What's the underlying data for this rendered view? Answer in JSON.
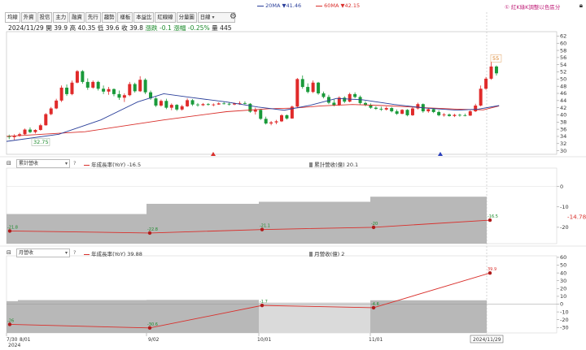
{
  "legend_top": {
    "ma20_label": "20MA",
    "ma20_value": "▼41.46",
    "ma60_label": "60MA",
    "ma60_value": "▼42.15",
    "note": "① 紅K綠K調整以色區分",
    "ma20_color": "#2a3f9a",
    "ma60_color": "#d9302c"
  },
  "toolbar": {
    "tabs": [
      "均線",
      "外資",
      "投信",
      "主力",
      "融資",
      "先行",
      "趨勢",
      "樣板",
      "本益比",
      "紅線線",
      "分量圖"
    ],
    "period": "日線",
    "settings_icon": "gear-icon"
  },
  "quote": {
    "date": "2024/11/29",
    "open": "開 39.9",
    "high": "高 40.35",
    "low": "低 39.6",
    "close": "收 39.8",
    "change": "漲跌 -0.1",
    "change_pct": "漲幅 -0.25%",
    "volume": "量 445"
  },
  "panel2": {
    "select": "累計營收",
    "help": "?",
    "legend_line": "年成長率(YoY) -16.5",
    "legend_bar": "累計營收(億) 20.1"
  },
  "panel3": {
    "select": "月營收",
    "help": "?",
    "legend_line": "年成長率(YoY) 39.88",
    "legend_bar": "月營收(億) 2"
  },
  "chart_data": [
    {
      "type": "candlestick",
      "yticks": [
        30,
        32,
        34,
        36,
        38,
        40,
        42,
        44,
        46,
        48,
        50,
        52,
        54,
        56,
        58,
        60,
        62
      ],
      "ylim": [
        29,
        63
      ],
      "x_range": [
        0,
        105
      ],
      "candles": [
        [
          34.1,
          34.5,
          33.2,
          33.8
        ],
        [
          33.8,
          34.6,
          33.0,
          34.2
        ],
        [
          34.2,
          35.0,
          33.9,
          34.6
        ],
        [
          34.6,
          36.2,
          34.4,
          35.9
        ],
        [
          35.9,
          36.5,
          34.9,
          35.2
        ],
        [
          35.2,
          36.0,
          34.8,
          35.8
        ],
        [
          35.8,
          37.5,
          35.6,
          37.1
        ],
        [
          37.1,
          40.5,
          37.0,
          40.2
        ],
        [
          40.2,
          42.2,
          39.9,
          41.8
        ],
        [
          41.8,
          44.5,
          41.6,
          44.0
        ],
        [
          44.0,
          48.2,
          43.6,
          47.6
        ],
        [
          47.6,
          48.5,
          45.3,
          45.8
        ],
        [
          45.8,
          49.6,
          45.5,
          49.0
        ],
        [
          49.0,
          52.5,
          48.8,
          52.2
        ],
        [
          52.2,
          52.5,
          48.7,
          49.2
        ],
        [
          49.2,
          50.2,
          47.0,
          47.6
        ],
        [
          47.6,
          49.6,
          47.3,
          49.2
        ],
        [
          49.2,
          49.5,
          46.8,
          47.3
        ],
        [
          47.3,
          48.2,
          45.8,
          46.5
        ],
        [
          46.5,
          47.8,
          45.6,
          47.2
        ],
        [
          47.2,
          47.4,
          45.2,
          45.8
        ],
        [
          45.8,
          46.8,
          44.2,
          44.8
        ],
        [
          44.8,
          46.0,
          43.6,
          45.5
        ],
        [
          45.5,
          49.2,
          45.2,
          48.6
        ],
        [
          48.6,
          49.0,
          46.2,
          46.6
        ],
        [
          46.6,
          50.8,
          46.4,
          49.8
        ],
        [
          49.8,
          50.2,
          45.8,
          46.3
        ],
        [
          46.3,
          46.8,
          44.2,
          44.6
        ],
        [
          44.6,
          45.0,
          42.2,
          42.6
        ],
        [
          42.6,
          44.3,
          42.3,
          43.9
        ],
        [
          43.9,
          44.5,
          41.6,
          42.0
        ],
        [
          42.0,
          43.2,
          41.3,
          42.8
        ],
        [
          42.8,
          43.0,
          41.1,
          41.5
        ],
        [
          41.5,
          42.8,
          41.2,
          42.4
        ],
        [
          42.4,
          44.6,
          42.2,
          44.1
        ],
        [
          44.1,
          44.4,
          42.5,
          42.9
        ],
        [
          42.9,
          43.3,
          42.3,
          42.7
        ],
        [
          42.7,
          43.3,
          42.5,
          43.0
        ],
        [
          43.0,
          43.3,
          42.6,
          42.8
        ],
        [
          42.8,
          43.2,
          42.4,
          42.9
        ],
        [
          42.9,
          43.5,
          42.8,
          43.2
        ],
        [
          43.2,
          43.6,
          42.9,
          43.1
        ],
        [
          43.1,
          43.4,
          42.6,
          42.9
        ],
        [
          42.9,
          43.4,
          42.7,
          43.2
        ],
        [
          43.2,
          43.8,
          42.8,
          43.3
        ],
        [
          43.3,
          43.8,
          42.9,
          43.1
        ],
        [
          43.1,
          43.3,
          40.6,
          40.9
        ],
        [
          40.9,
          42.0,
          40.1,
          41.4
        ],
        [
          41.4,
          41.6,
          38.6,
          38.9
        ],
        [
          38.9,
          39.5,
          37.3,
          37.6
        ],
        [
          37.6,
          38.3,
          37.1,
          37.9
        ],
        [
          37.9,
          38.6,
          37.4,
          38.2
        ],
        [
          38.2,
          40.2,
          38.0,
          39.9
        ],
        [
          39.9,
          40.1,
          38.7,
          39.0
        ],
        [
          39.0,
          42.6,
          38.9,
          42.3
        ],
        [
          42.3,
          50.3,
          42.1,
          50.0
        ],
        [
          50.0,
          51.0,
          47.3,
          47.8
        ],
        [
          47.8,
          48.8,
          46.0,
          46.4
        ],
        [
          46.4,
          49.6,
          46.1,
          49.0
        ],
        [
          49.0,
          49.2,
          45.6,
          46.0
        ],
        [
          46.0,
          46.5,
          44.6,
          45.0
        ],
        [
          45.0,
          45.6,
          43.0,
          43.4
        ],
        [
          43.4,
          44.3,
          42.4,
          42.7
        ],
        [
          42.7,
          45.2,
          42.5,
          44.8
        ],
        [
          44.8,
          45.2,
          43.3,
          43.7
        ],
        [
          43.7,
          46.2,
          43.5,
          45.8
        ],
        [
          45.8,
          46.3,
          44.6,
          45.0
        ],
        [
          45.0,
          45.4,
          42.9,
          43.3
        ],
        [
          43.3,
          43.8,
          42.4,
          42.8
        ],
        [
          42.8,
          43.2,
          41.7,
          42.0
        ],
        [
          42.0,
          42.4,
          41.4,
          41.7
        ],
        [
          41.7,
          42.3,
          41.1,
          41.5
        ],
        [
          41.5,
          42.3,
          41.2,
          41.9
        ],
        [
          41.9,
          42.2,
          40.7,
          41.0
        ],
        [
          41.0,
          41.5,
          40.0,
          40.3
        ],
        [
          40.3,
          41.6,
          40.2,
          41.4
        ],
        [
          41.4,
          41.6,
          39.6,
          39.9
        ],
        [
          39.9,
          42.2,
          39.7,
          41.8
        ],
        [
          41.8,
          43.4,
          41.5,
          43.0
        ],
        [
          43.0,
          43.2,
          40.6,
          41.0
        ],
        [
          41.0,
          41.9,
          40.6,
          41.6
        ],
        [
          41.6,
          41.9,
          40.5,
          40.8
        ],
        [
          40.8,
          41.3,
          39.6,
          39.9
        ],
        [
          39.9,
          40.5,
          39.5,
          40.1
        ],
        [
          40.1,
          40.4,
          39.5,
          39.7
        ],
        [
          39.7,
          40.3,
          39.4,
          40.0
        ],
        [
          40.0,
          40.3,
          39.5,
          39.9
        ],
        [
          39.9,
          40.35,
          39.6,
          39.8
        ],
        [
          39.8,
          41.3,
          39.7,
          41.0
        ],
        [
          41.0,
          43.1,
          40.8,
          42.6
        ],
        [
          42.6,
          48.2,
          42.4,
          47.3
        ],
        [
          47.3,
          50.6,
          47.0,
          50.1
        ],
        [
          50.1,
          55.0,
          49.8,
          53.5
        ],
        [
          53.5,
          53.8,
          51.0,
          51.6
        ]
      ],
      "ma20": [
        [
          0,
          32.6
        ],
        [
          10,
          34.6
        ],
        [
          18,
          38.6
        ],
        [
          25,
          43.6
        ],
        [
          30,
          45.9
        ],
        [
          35,
          44.9
        ],
        [
          42,
          43.6
        ],
        [
          48,
          42.2
        ],
        [
          53,
          41.3
        ],
        [
          58,
          42.7
        ],
        [
          63,
          44.6
        ],
        [
          68,
          44.2
        ],
        [
          74,
          42.9
        ],
        [
          80,
          41.9
        ],
        [
          86,
          41.3
        ],
        [
          90,
          41.6
        ],
        [
          94,
          42.6
        ]
      ],
      "ma60": [
        [
          0,
          34.0
        ],
        [
          15,
          35.3
        ],
        [
          30,
          38.6
        ],
        [
          42,
          40.9
        ],
        [
          50,
          41.7
        ],
        [
          55,
          41.9
        ],
        [
          60,
          42.5
        ],
        [
          66,
          42.9
        ],
        [
          72,
          42.6
        ],
        [
          80,
          42.0
        ],
        [
          86,
          41.6
        ],
        [
          91,
          41.4
        ],
        [
          94,
          42.5
        ]
      ],
      "labels": [
        {
          "index": 4,
          "text": "32.75",
          "value": 32.75
        },
        {
          "index": 93,
          "text": "55",
          "value": 55
        }
      ]
    },
    {
      "type": "bar+line",
      "yticks": [
        0,
        -10,
        -20
      ],
      "ylim": [
        -28,
        9
      ],
      "current_value": "-14.78",
      "bars": [
        -13.5,
        -8.5,
        -7.5,
        -5.0
      ],
      "line_points": [
        -21.8,
        -22.8,
        -21.1,
        -20,
        -16.5
      ],
      "point_labels": [
        "-21.8",
        "-22.8",
        "-21.1",
        "-20",
        "-16.5"
      ]
    },
    {
      "type": "bar+line",
      "yticks": [
        60,
        50,
        40,
        30,
        20,
        10,
        0,
        -10,
        -20,
        -30
      ],
      "ylim": [
        -37,
        62
      ],
      "bars": [
        5.2,
        5.4,
        2.1,
        4.9
      ],
      "line_points": [
        -26,
        -30.6,
        -1.7,
        -4.6,
        39.9
      ],
      "point_labels": [
        "-26",
        "-30.6",
        "-1.7",
        "-4.6",
        "39.9"
      ]
    }
  ],
  "xaxis": {
    "labels": [
      "7/30",
      "8/01",
      "9/02",
      "10/01",
      "11/01",
      "2024/11/29"
    ],
    "year": "2024"
  }
}
